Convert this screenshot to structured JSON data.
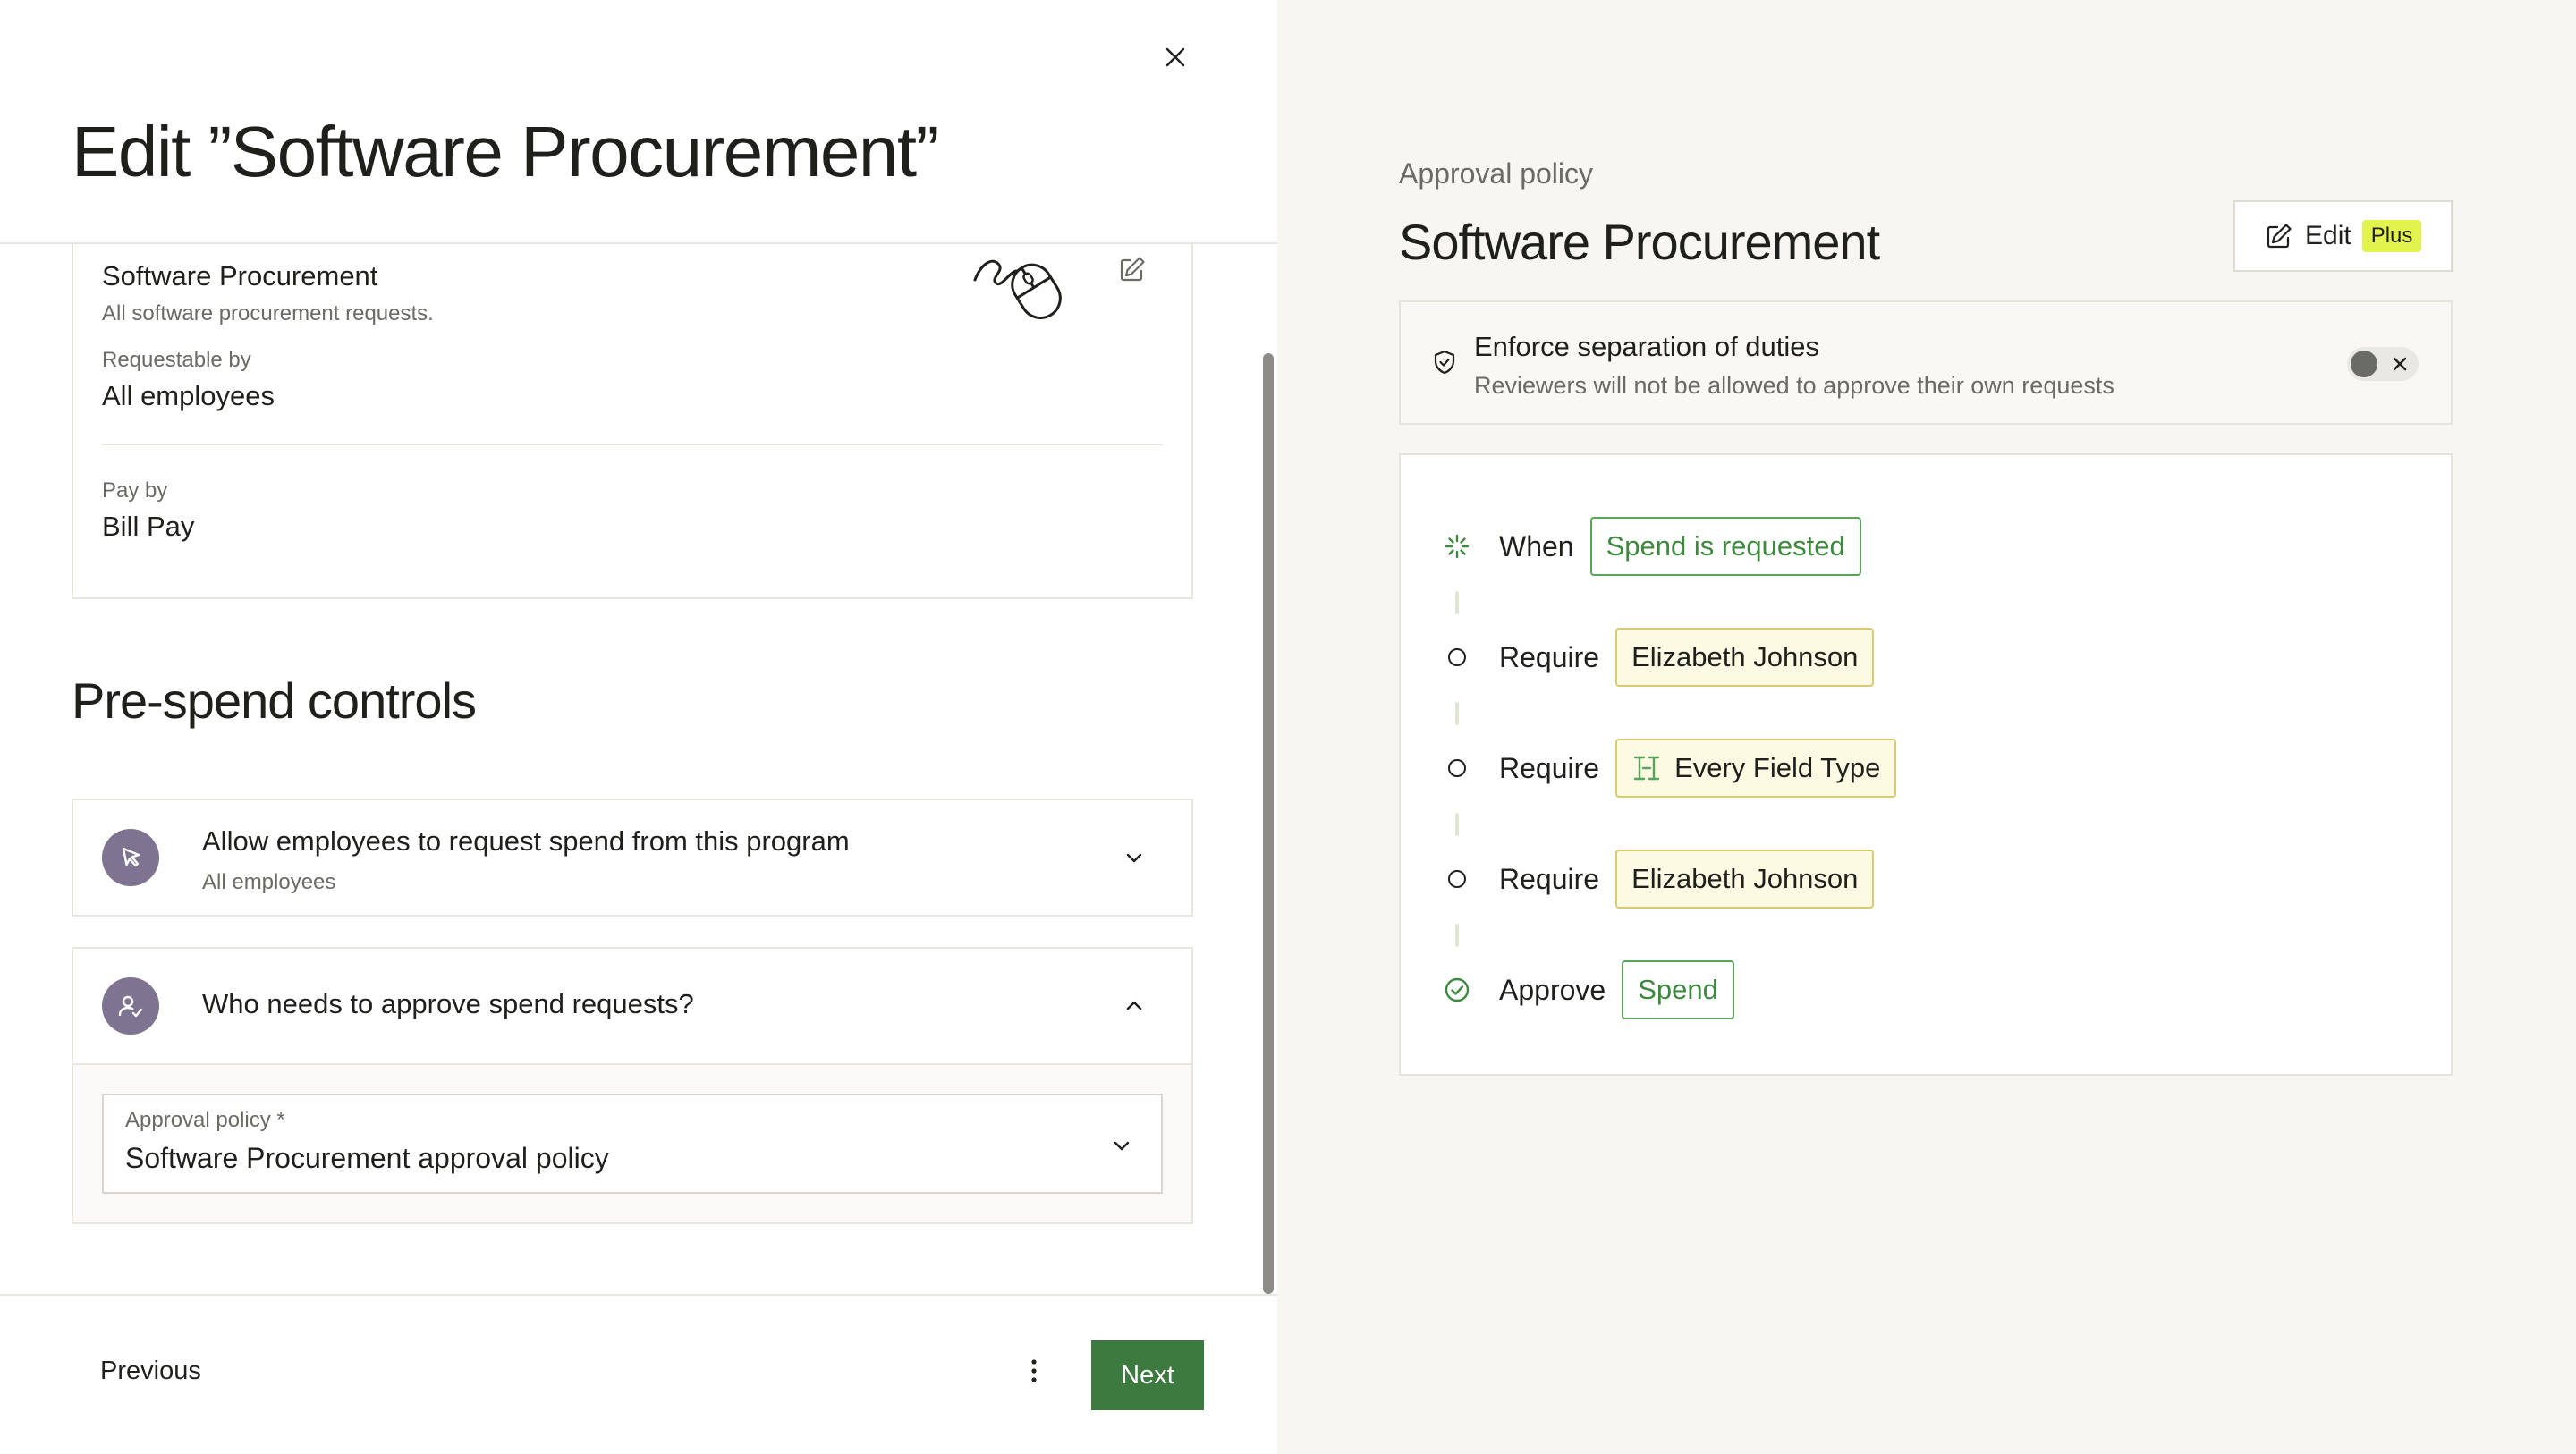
{
  "left": {
    "title": "Edit ”Software Procurement”",
    "details": {
      "name": "Software Procurement",
      "description": "All software procurement requests.",
      "requestable_label": "Requestable by",
      "requestable_value": "All employees",
      "pay_label": "Pay by",
      "pay_value": "Bill Pay"
    },
    "section_title": "Pre-spend controls",
    "accordions": [
      {
        "title": "Allow employees to request spend from this program",
        "subtitle": "All employees",
        "icon": "cursor-icon",
        "expanded": false
      },
      {
        "title": "Who needs to approve spend requests?",
        "icon": "user-check-icon",
        "expanded": true
      }
    ],
    "approval_select": {
      "label": "Approval policy *",
      "value": "Software Procurement approval policy"
    },
    "footer": {
      "previous": "Previous",
      "next": "Next"
    }
  },
  "right": {
    "eyebrow": "Approval policy",
    "title": "Software Procurement",
    "edit_label": "Edit",
    "plus_badge": "Plus",
    "separation": {
      "title": "Enforce separation of duties",
      "description": "Reviewers will not be allowed to approve their own requests",
      "enabled": false
    },
    "flow": [
      {
        "icon": "loader-icon",
        "verb": "When",
        "chip": "Spend is requested",
        "chip_style": "green"
      },
      {
        "icon": "circle-icon",
        "verb": "Require",
        "chip": "Elizabeth Johnson",
        "chip_style": "yellow"
      },
      {
        "icon": "circle-icon",
        "verb": "Require",
        "chip": "Every Field Type",
        "chip_style": "yellow",
        "chip_icon": "text-cursor-icon"
      },
      {
        "icon": "circle-icon",
        "verb": "Require",
        "chip": "Elizabeth Johnson",
        "chip_style": "yellow"
      },
      {
        "icon": "check-circle-icon",
        "verb": "Approve",
        "chip": "Spend",
        "chip_style": "green"
      }
    ]
  },
  "colors": {
    "primary_green": "#3d7a3f",
    "chip_green": "#3d8a3f",
    "chip_yellow_bg": "#fdfae3",
    "plus_badge": "#e2f34e",
    "avatar_purple": "#7e7390",
    "right_panel_bg": "#f7f6f3"
  }
}
